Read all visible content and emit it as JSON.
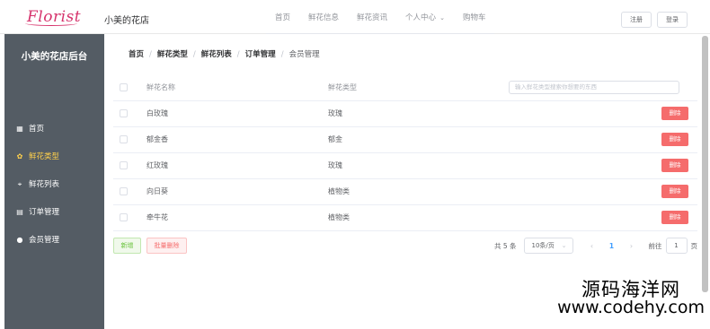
{
  "header": {
    "logo_text": "Florist",
    "shop_name": "小美的花店",
    "nav": [
      "首页",
      "鲜花信息",
      "鲜花资讯",
      "个人中心",
      "购物车"
    ],
    "register": "注册",
    "login": "登录"
  },
  "sidebar": {
    "title": "小美的花店后台",
    "items": [
      {
        "label": "首页",
        "icon": "grid-icon",
        "glyph": "▦"
      },
      {
        "label": "鲜花类型",
        "icon": "flower-icon",
        "glyph": "✿",
        "active": true
      },
      {
        "label": "鲜花列表",
        "icon": "location-icon",
        "glyph": "⌖"
      },
      {
        "label": "订单管理",
        "icon": "document-icon",
        "glyph": "▤"
      },
      {
        "label": "会员管理",
        "icon": "user-icon",
        "glyph": "●"
      }
    ]
  },
  "breadcrumb": [
    "首页",
    "鲜花类型",
    "鲜花列表",
    "订单管理",
    "会员管理"
  ],
  "table": {
    "columns": [
      "鲜花名称",
      "鲜花类型"
    ],
    "search_placeholder": "输入鲜花类型搜索你想要的东西",
    "delete_label": "删除",
    "rows": [
      {
        "name": "白玫瑰",
        "type": "玫瑰"
      },
      {
        "name": "郁金香",
        "type": "郁金"
      },
      {
        "name": "红玫瑰",
        "type": "玫瑰"
      },
      {
        "name": "向日葵",
        "type": "植物类"
      },
      {
        "name": "牵牛花",
        "type": "植物类"
      }
    ]
  },
  "actions": {
    "add": "新增",
    "batch_delete": "批量删除"
  },
  "pagination": {
    "total": "共 5 条",
    "page_size": "10条/页",
    "current_page": "1",
    "goto_label": "前往",
    "goto_value": "1",
    "page_unit": "页"
  },
  "watermark": {
    "line1": "源码海洋网",
    "line2": "www.codehy.com"
  },
  "colors": {
    "sidebar_bg": "#545c64",
    "active": "#ffd04b",
    "danger": "#f56c6c",
    "primary": "#409eff"
  }
}
